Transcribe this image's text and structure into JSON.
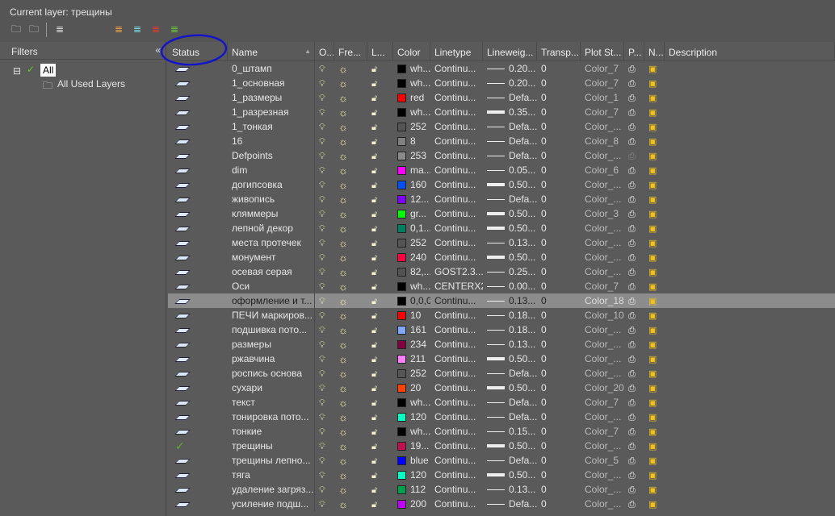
{
  "current_layer_label": "Current layer: трещины",
  "filters": {
    "title": "Filters",
    "collapse": "«",
    "tree": [
      {
        "label": "All"
      },
      {
        "label": "All Used Layers"
      }
    ]
  },
  "columns": [
    "Status",
    "Name",
    "O...",
    "Fre...",
    "L...",
    "Color",
    "Linetype",
    "Lineweig...",
    "Transp...",
    "Plot St...",
    "P...",
    "N...",
    "Description"
  ],
  "rows": [
    {
      "name": "0_штамп",
      "color": "wh...",
      "hex": "#000000",
      "lt": "Continu...",
      "lw": "0.20...",
      "thick": false,
      "tr": "0",
      "ps": "Color_7"
    },
    {
      "name": "1_основная",
      "color": "wh...",
      "hex": "#000000",
      "lt": "Continu...",
      "lw": "0.20...",
      "thick": false,
      "tr": "0",
      "ps": "Color_7"
    },
    {
      "name": "1_размеры",
      "color": "red",
      "hex": "#ff0000",
      "lt": "Continu...",
      "lw": "Defa...",
      "thick": false,
      "tr": "0",
      "ps": "Color_1"
    },
    {
      "name": "1_разрезная",
      "color": "wh...",
      "hex": "#000000",
      "lt": "Continu...",
      "lw": "0.35...",
      "thick": true,
      "tr": "0",
      "ps": "Color_7"
    },
    {
      "name": "1_тонкая",
      "color": "252",
      "hex": "#555555",
      "lt": "Continu...",
      "lw": "Defa...",
      "thick": false,
      "tr": "0",
      "ps": "Color_..."
    },
    {
      "name": "16",
      "color": "8",
      "hex": "#808080",
      "lt": "Continu...",
      "lw": "Defa...",
      "thick": false,
      "tr": "0",
      "ps": "Color_8"
    },
    {
      "name": "Defpoints",
      "color": "253",
      "hex": "#8a8a8a",
      "lt": "Continu...",
      "lw": "Defa...",
      "thick": false,
      "tr": "0",
      "ps": "Color_...",
      "noplot": true
    },
    {
      "name": "dim",
      "color": "ma...",
      "hex": "#ff00ff",
      "lt": "Continu...",
      "lw": "0.05...",
      "thick": false,
      "tr": "0",
      "ps": "Color_6"
    },
    {
      "name": "догипсовка",
      "color": "160",
      "hex": "#0050ff",
      "lt": "Continu...",
      "lw": "0.50...",
      "thick": true,
      "tr": "0",
      "ps": "Color_..."
    },
    {
      "name": "живопись",
      "color": "12...",
      "hex": "#8000ff",
      "lt": "Continu...",
      "lw": "Defa...",
      "thick": false,
      "tr": "0",
      "ps": "Color_..."
    },
    {
      "name": "кляммеры",
      "color": "gr...",
      "hex": "#00ff00",
      "lt": "Continu...",
      "lw": "0.50...",
      "thick": true,
      "tr": "0",
      "ps": "Color_3"
    },
    {
      "name": "лепной декор",
      "color": "0,1...",
      "hex": "#008060",
      "lt": "Continu...",
      "lw": "0.50...",
      "thick": true,
      "tr": "0",
      "ps": "Color_..."
    },
    {
      "name": "места протечек",
      "color": "252",
      "hex": "#555555",
      "lt": "Continu...",
      "lw": "0.13...",
      "thick": false,
      "tr": "0",
      "ps": "Color_..."
    },
    {
      "name": "монумент",
      "color": "240",
      "hex": "#ff0040",
      "lt": "Continu...",
      "lw": "0.50...",
      "thick": true,
      "tr": "0",
      "ps": "Color_..."
    },
    {
      "name": "осевая серая",
      "color": "82,...",
      "hex": "#525252",
      "lt": "GOST2.3...",
      "lw": "0.25...",
      "thick": false,
      "tr": "0",
      "ps": "Color_..."
    },
    {
      "name": "Оси",
      "color": "wh...",
      "hex": "#000000",
      "lt": "CENTERX2",
      "lw": "0.00...",
      "thick": false,
      "tr": "0",
      "ps": "Color_7"
    },
    {
      "name": "оформление и т...",
      "color": "0,0,0",
      "hex": "#000000",
      "lt": "Continu...",
      "lw": "0.13...",
      "thick": false,
      "tr": "0",
      "ps": "Color_18",
      "selected": true
    },
    {
      "name": "ПЕЧИ маркиров...",
      "color": "10",
      "hex": "#ff0000",
      "lt": "Continu...",
      "lw": "0.18...",
      "thick": false,
      "tr": "0",
      "ps": "Color_10"
    },
    {
      "name": "подшивка пото...",
      "color": "161",
      "hex": "#80a8ff",
      "lt": "Continu...",
      "lw": "0.18...",
      "thick": false,
      "tr": "0",
      "ps": "Color_..."
    },
    {
      "name": "размеры",
      "color": "234",
      "hex": "#800040",
      "lt": "Continu...",
      "lw": "0.13...",
      "thick": false,
      "tr": "0",
      "ps": "Color_..."
    },
    {
      "name": "ржавчина",
      "color": "211",
      "hex": "#ff80ff",
      "lt": "Continu...",
      "lw": "0.50...",
      "thick": true,
      "tr": "0",
      "ps": "Color_..."
    },
    {
      "name": "роспись основа",
      "color": "252",
      "hex": "#555555",
      "lt": "Continu...",
      "lw": "Defa...",
      "thick": false,
      "tr": "0",
      "ps": "Color_..."
    },
    {
      "name": "сухари",
      "color": "20",
      "hex": "#ff4000",
      "lt": "Continu...",
      "lw": "0.50...",
      "thick": true,
      "tr": "0",
      "ps": "Color_20"
    },
    {
      "name": "текст",
      "color": "wh...",
      "hex": "#000000",
      "lt": "Continu...",
      "lw": "Defa...",
      "thick": false,
      "tr": "0",
      "ps": "Color_7"
    },
    {
      "name": "тонировка пото...",
      "color": "120",
      "hex": "#00ffc0",
      "lt": "Continu...",
      "lw": "Defa...",
      "thick": false,
      "tr": "0",
      "ps": "Color_..."
    },
    {
      "name": "тонкие",
      "color": "wh...",
      "hex": "#000000",
      "lt": "Continu...",
      "lw": "0.15...",
      "thick": false,
      "tr": "0",
      "ps": "Color_7"
    },
    {
      "name": "трещины",
      "color": "19...",
      "hex": "#c01050",
      "lt": "Continu...",
      "lw": "0.50...",
      "thick": true,
      "tr": "0",
      "ps": "Color_...",
      "current": true
    },
    {
      "name": "трещины лепно...",
      "color": "blue",
      "hex": "#0000ff",
      "lt": "Continu...",
      "lw": "Defa...",
      "thick": false,
      "tr": "0",
      "ps": "Color_5"
    },
    {
      "name": "тяга",
      "color": "120",
      "hex": "#00ffc0",
      "lt": "Continu...",
      "lw": "0.50...",
      "thick": true,
      "tr": "0",
      "ps": "Color_..."
    },
    {
      "name": "удаление загряз...",
      "color": "112",
      "hex": "#00a050",
      "lt": "Continu...",
      "lw": "0.13...",
      "thick": false,
      "tr": "0",
      "ps": "Color_..."
    },
    {
      "name": "усиление подш...",
      "color": "200",
      "hex": "#c000ff",
      "lt": "Continu...",
      "lw": "Defa...",
      "thick": false,
      "tr": "0",
      "ps": "Color_..."
    }
  ]
}
